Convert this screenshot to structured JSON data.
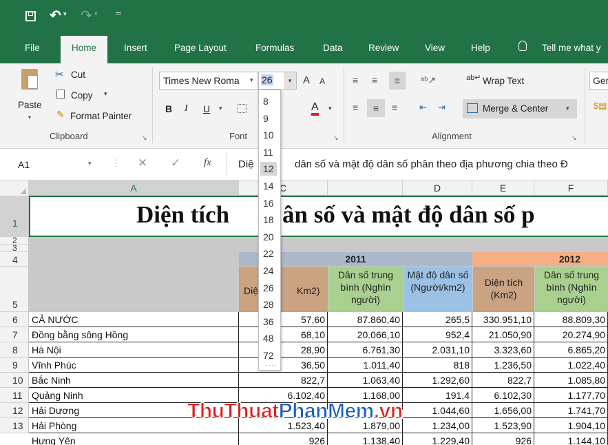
{
  "colors": {
    "accent": "#217346",
    "year2011": "#acb9ca",
    "year2012": "#f4b084",
    "area_col": "#c9a382",
    "pop_col": "#a9d08e",
    "dens_col": "#9bc2e6",
    "text_red": "#e02020"
  },
  "qat": {
    "save_icon": "save-icon",
    "undo_icon": "undo-icon",
    "redo_icon": "redo-icon",
    "customize_icon": "customize-icon"
  },
  "tabs": {
    "file": "File",
    "home": "Home",
    "insert": "Insert",
    "page_layout": "Page Layout",
    "formulas": "Formulas",
    "data": "Data",
    "review": "Review",
    "view": "View",
    "help": "Help",
    "tell_me": "Tell me what y"
  },
  "clipboard": {
    "paste": "Paste",
    "cut": "Cut",
    "copy": "Copy",
    "format_painter": "Format Painter",
    "label": "Clipboard"
  },
  "font": {
    "name": "Times New Roma",
    "size": "26",
    "label": "Font",
    "bold": "B",
    "italic": "I",
    "underline": "U",
    "color_letter": "A",
    "grow": "A",
    "shrink": "A"
  },
  "alignment": {
    "wrap": "Wrap Text",
    "merge": "Merge & Center",
    "label": "Alignment"
  },
  "number": {
    "format": "Ger"
  },
  "namebox": "A1",
  "formula": {
    "prefix": "Diệ",
    "text": "dân số và mật độ dân số phân theo địa phương chia theo Đ",
    "fx": "fx"
  },
  "size_options": [
    "8",
    "9",
    "10",
    "11",
    "12",
    "14",
    "16",
    "18",
    "20",
    "22",
    "24",
    "26",
    "28",
    "36",
    "48",
    "72"
  ],
  "size_highlight": "12",
  "columns": [
    "A",
    "C",
    "D",
    "E",
    "F"
  ],
  "rows": [
    "1",
    "2",
    "3",
    "4",
    "5",
    "6",
    "7",
    "8",
    "9",
    "10",
    "11",
    "12",
    "13"
  ],
  "sheet": {
    "title_left": "Diện tích",
    "title_right": "ân số và mật độ dân số p",
    "year1": "2011",
    "year2": "2012",
    "h_area_left": "Diệ",
    "h_area_right": "Km2)",
    "h_pop": "Dân số trung bình (Nghìn người)",
    "h_dens": "Mật độ dân số (Người/km2)",
    "h_area2": "Diện tích (Km2)",
    "h_pop2": "Dân số trung bình (Nghìn người)",
    "data": [
      {
        "name": "CẢ NƯỚC",
        "b": "57,60",
        "c": "87.860,40",
        "d": "265,5",
        "e": "330.951,10",
        "f": "88.809,30"
      },
      {
        "name": "Đồng bằng sông Hồng",
        "b": "68,10",
        "c": "20.066,10",
        "d": "952,4",
        "e": "21.050,90",
        "f": "20.274,90"
      },
      {
        "name": "Hà Nội",
        "b": "28,90",
        "c": "6.761,30",
        "d": "2.031,10",
        "e": "3.323,60",
        "f": "6.865,20"
      },
      {
        "name": "Vĩnh Phúc",
        "b": "36,50",
        "c": "1.011,40",
        "d": "818",
        "e": "1.236,50",
        "f": "1.022,40"
      },
      {
        "name": "Bắc Ninh",
        "b": "822,7",
        "c": "1.063,40",
        "d": "1.292,60",
        "e": "822,7",
        "f": "1.085,80"
      },
      {
        "name": "Quảng Ninh",
        "b": "6.102,40",
        "c": "1.168,00",
        "d": "191,4",
        "e": "6.102,30",
        "f": "1.177,70"
      },
      {
        "name": "Hải Dương",
        "b": "",
        "c": "",
        "d": "1.044,60",
        "e": "1.656,00",
        "f": "1.741,70"
      },
      {
        "name": "Hải Phòng",
        "b": "1.523,40",
        "c": "1.879,00",
        "d": "1.234,00",
        "e": "1.523,90",
        "f": "1.904,10"
      },
      {
        "name": "Hưng Yên",
        "b": "926",
        "c": "1.138,40",
        "d": "1.229,40",
        "e": "926",
        "f": "1.144,10"
      }
    ]
  },
  "watermark": {
    "part1": "ThuThuat",
    "part2": "PhanMem",
    "part3": ".vn"
  }
}
